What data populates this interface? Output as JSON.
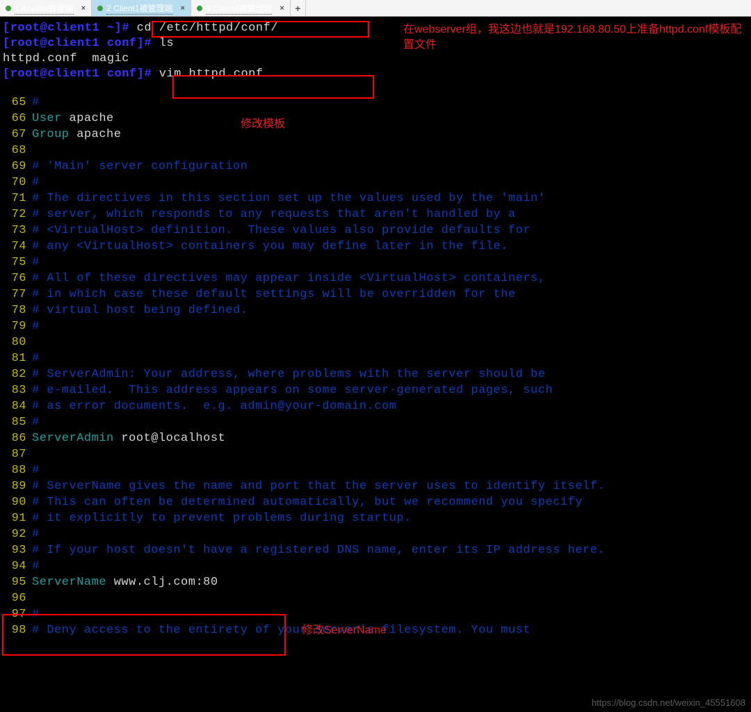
{
  "tabs": [
    {
      "n": "1",
      "label": "Ansible管理端",
      "active": false
    },
    {
      "n": "2",
      "label": "Client1被管理端",
      "active": true
    },
    {
      "n": "3",
      "label": "Client2被管理端",
      "active": false
    }
  ],
  "prompt_parts": {
    "user_host": "root@client1",
    "hash": "#"
  },
  "cmd_lines": [
    {
      "dir": "~",
      "cmd": "cd /etc/httpd/conf/"
    },
    {
      "dir": "conf",
      "cmd": "ls"
    }
  ],
  "ls_output": "httpd.conf  magic",
  "cmd3": {
    "dir": "conf",
    "cmd": "vim httpd.conf"
  },
  "annotations": {
    "right": "在webserver组，我这边也就是192.168.80.50上准备httpd.conf模板配置文件",
    "mid": "修改模板",
    "bottom": "修改ServerName"
  },
  "editor_lines": [
    {
      "n": 65,
      "seg": [
        {
          "c": "cmt",
          "t": "#"
        }
      ]
    },
    {
      "n": 66,
      "seg": [
        {
          "c": "kw",
          "t": "User"
        },
        {
          "c": "txt",
          "t": " apache"
        }
      ]
    },
    {
      "n": 67,
      "seg": [
        {
          "c": "kw",
          "t": "Group"
        },
        {
          "c": "txt",
          "t": " apache"
        }
      ]
    },
    {
      "n": 68,
      "seg": []
    },
    {
      "n": 69,
      "seg": [
        {
          "c": "cmt",
          "t": "# 'Main' server configuration"
        }
      ]
    },
    {
      "n": 70,
      "seg": [
        {
          "c": "cmt",
          "t": "#"
        }
      ]
    },
    {
      "n": 71,
      "seg": [
        {
          "c": "cmt",
          "t": "# The directives in this section set up the values used by the 'main'"
        }
      ]
    },
    {
      "n": 72,
      "seg": [
        {
          "c": "cmt",
          "t": "# server, which responds to any requests that aren't handled by a"
        }
      ]
    },
    {
      "n": 73,
      "seg": [
        {
          "c": "cmt",
          "t": "# <VirtualHost> definition.  These values also provide defaults for"
        }
      ]
    },
    {
      "n": 74,
      "seg": [
        {
          "c": "cmt",
          "t": "# any <VirtualHost> containers you may define later in the file."
        }
      ]
    },
    {
      "n": 75,
      "seg": [
        {
          "c": "cmt",
          "t": "#"
        }
      ]
    },
    {
      "n": 76,
      "seg": [
        {
          "c": "cmt",
          "t": "# All of these directives may appear inside <VirtualHost> containers,"
        }
      ]
    },
    {
      "n": 77,
      "seg": [
        {
          "c": "cmt",
          "t": "# in which case these default settings will be overridden for the"
        }
      ]
    },
    {
      "n": 78,
      "seg": [
        {
          "c": "cmt",
          "t": "# virtual host being defined."
        }
      ]
    },
    {
      "n": 79,
      "seg": [
        {
          "c": "cmt",
          "t": "#"
        }
      ]
    },
    {
      "n": 80,
      "seg": []
    },
    {
      "n": 81,
      "seg": [
        {
          "c": "cmt",
          "t": "#"
        }
      ]
    },
    {
      "n": 82,
      "seg": [
        {
          "c": "cmt",
          "t": "# ServerAdmin: Your address, where problems with the server should be"
        }
      ]
    },
    {
      "n": 83,
      "seg": [
        {
          "c": "cmt",
          "t": "# e-mailed.  This address appears on some server-generated pages, such"
        }
      ]
    },
    {
      "n": 84,
      "seg": [
        {
          "c": "cmt",
          "t": "# as error documents.  e.g. admin@your-domain.com"
        }
      ]
    },
    {
      "n": 85,
      "seg": [
        {
          "c": "cmt",
          "t": "#"
        }
      ]
    },
    {
      "n": 86,
      "seg": [
        {
          "c": "kw",
          "t": "ServerAdmin"
        },
        {
          "c": "txt",
          "t": " root@localhost"
        }
      ]
    },
    {
      "n": 87,
      "seg": []
    },
    {
      "n": 88,
      "seg": [
        {
          "c": "cmt",
          "t": "#"
        }
      ]
    },
    {
      "n": 89,
      "seg": [
        {
          "c": "cmt",
          "t": "# ServerName gives the name and port that the server uses to identify itself."
        }
      ]
    },
    {
      "n": 90,
      "seg": [
        {
          "c": "cmt",
          "t": "# This can often be determined automatically, but we recommend you specify"
        }
      ]
    },
    {
      "n": 91,
      "seg": [
        {
          "c": "cmt",
          "t": "# it explicitly to prevent problems during startup."
        }
      ]
    },
    {
      "n": 92,
      "seg": [
        {
          "c": "cmt",
          "t": "#"
        }
      ]
    },
    {
      "n": 93,
      "seg": [
        {
          "c": "cmt",
          "t": "# If your host doesn't have a registered DNS name, enter its IP address here."
        }
      ]
    },
    {
      "n": 94,
      "seg": [
        {
          "c": "cmt",
          "t": "#"
        }
      ]
    },
    {
      "n": 95,
      "seg": [
        {
          "c": "kw",
          "t": "ServerName"
        },
        {
          "c": "txt",
          "t": " www.clj.com:80"
        }
      ]
    },
    {
      "n": 96,
      "seg": []
    },
    {
      "n": 97,
      "seg": [
        {
          "c": "cmt",
          "t": "#"
        }
      ]
    },
    {
      "n": 98,
      "seg": [
        {
          "c": "cmt",
          "t": "# Deny access to the entirety of your server's filesystem. You must"
        }
      ]
    }
  ],
  "watermark": "https://blog.csdn.net/weixin_45551608"
}
